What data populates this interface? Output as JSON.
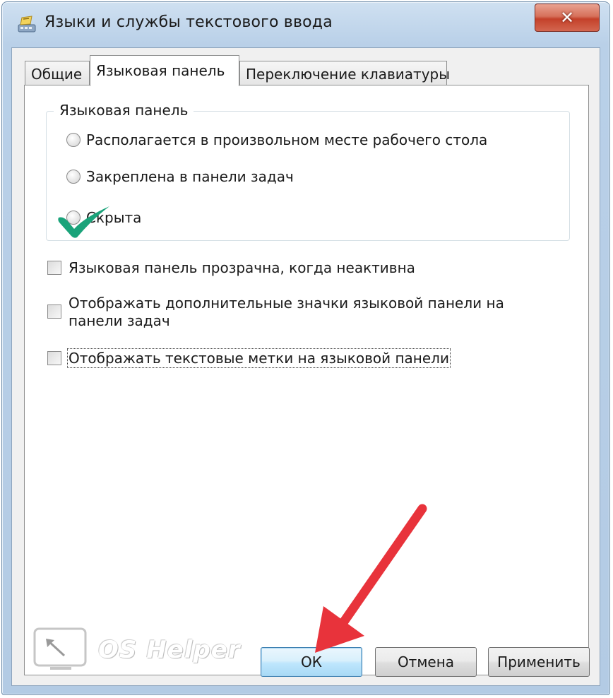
{
  "window": {
    "title": "Языки и службы текстового ввода",
    "close_glyph": "✕"
  },
  "tabs": [
    {
      "label": "Общие",
      "active": false
    },
    {
      "label": "Языковая панель",
      "active": true
    },
    {
      "label": "Переключение клавиатуры",
      "active": false
    }
  ],
  "language_bar_group": {
    "legend": "Языковая панель",
    "radios": [
      {
        "label": "Располагается в произвольном месте рабочего стола",
        "selected": false
      },
      {
        "label": "Закреплена в панели задач",
        "selected": true
      },
      {
        "label": "Скрыта",
        "selected": false
      }
    ]
  },
  "checkboxes": [
    {
      "label": "Языковая панель прозрачна, когда неактивна",
      "checked": false
    },
    {
      "label": "Отображать дополнительные значки языковой панели на панели задач",
      "checked": false
    },
    {
      "label": "Отображать текстовые метки на языковой панели",
      "checked": false
    }
  ],
  "watermark": {
    "text": "OS Helper"
  },
  "buttons": {
    "ok": "ОК",
    "cancel": "Отмена",
    "apply": "Применить"
  },
  "colors": {
    "annotation_check": "#1aa37a",
    "annotation_arrow": "#e8333b",
    "default_button_border": "#3c7fb1"
  }
}
